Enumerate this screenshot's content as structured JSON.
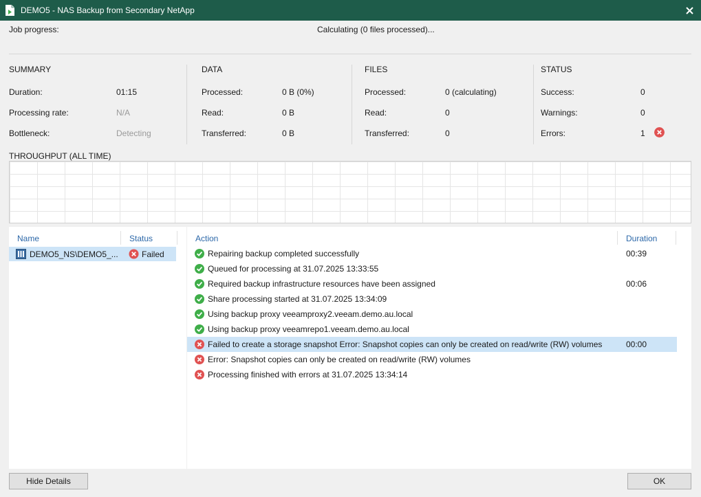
{
  "window": {
    "title": "DEMO5 - NAS Backup from Secondary NetApp"
  },
  "progress": {
    "label": "Job progress:",
    "value": "Calculating (0 files processed)..."
  },
  "summary": {
    "heading": "SUMMARY",
    "rows": [
      {
        "label": "Duration:",
        "value": "01:15"
      },
      {
        "label": "Processing rate:",
        "value": "N/A"
      },
      {
        "label": "Bottleneck:",
        "value": "Detecting"
      }
    ]
  },
  "data_section": {
    "heading": "DATA",
    "rows": [
      {
        "label": "Processed:",
        "value": "0 B (0%)"
      },
      {
        "label": "Read:",
        "value": "0 B"
      },
      {
        "label": "Transferred:",
        "value": "0 B"
      }
    ]
  },
  "files": {
    "heading": "FILES",
    "rows": [
      {
        "label": "Processed:",
        "value": "0 (calculating)"
      },
      {
        "label": "Read:",
        "value": "0"
      },
      {
        "label": "Transferred:",
        "value": "0"
      }
    ]
  },
  "status": {
    "heading": "STATUS",
    "rows": [
      {
        "label": "Success:",
        "value": "0"
      },
      {
        "label": "Warnings:",
        "value": "0"
      },
      {
        "label": "Errors:",
        "value": "1"
      }
    ]
  },
  "throughput": {
    "label": "THROUGHPUT (ALL TIME)"
  },
  "objects": {
    "columns": [
      "Name",
      "Status"
    ],
    "rows": [
      {
        "name": "DEMO5_NS\\DEMO5_...",
        "status": "Failed"
      }
    ]
  },
  "actions": {
    "columns": [
      "Action",
      "Duration"
    ],
    "rows": [
      {
        "status": "success",
        "text": "Repairing backup completed successfully",
        "duration": "00:39"
      },
      {
        "status": "success",
        "text": "Queued for processing at 31.07.2025 13:33:55",
        "duration": ""
      },
      {
        "status": "success",
        "text": "Required backup infrastructure resources have been assigned",
        "duration": "00:06"
      },
      {
        "status": "success",
        "text": "Share processing started at 31.07.2025 13:34:09",
        "duration": ""
      },
      {
        "status": "success",
        "text": "Using backup proxy veeamproxy2.veeam.demo.au.local",
        "duration": ""
      },
      {
        "status": "success",
        "text": "Using backup proxy veeamrepo1.veeam.demo.au.local",
        "duration": ""
      },
      {
        "status": "error",
        "text": "Failed to create a storage snapshot Error: Snapshot copies can only be created on read/write (RW) volumes",
        "duration": "00:00"
      },
      {
        "status": "error",
        "text": "Error: Snapshot copies can only be created on read/write (RW) volumes",
        "duration": ""
      },
      {
        "status": "error",
        "text": "Processing finished with errors at 31.07.2025 13:34:14",
        "duration": ""
      }
    ]
  },
  "buttons": {
    "hide_details": "Hide Details",
    "ok": "OK"
  },
  "colors": {
    "titlebar": "#1e5c4a",
    "success": "#3fae49",
    "error": "#e05252",
    "selection": "#cde4f7",
    "column_header": "#2b67a8"
  },
  "icons": {
    "app": "veeam-job-icon",
    "close": "close-icon",
    "success": "check-circle-icon",
    "error": "x-circle-icon",
    "share": "file-share-icon"
  }
}
